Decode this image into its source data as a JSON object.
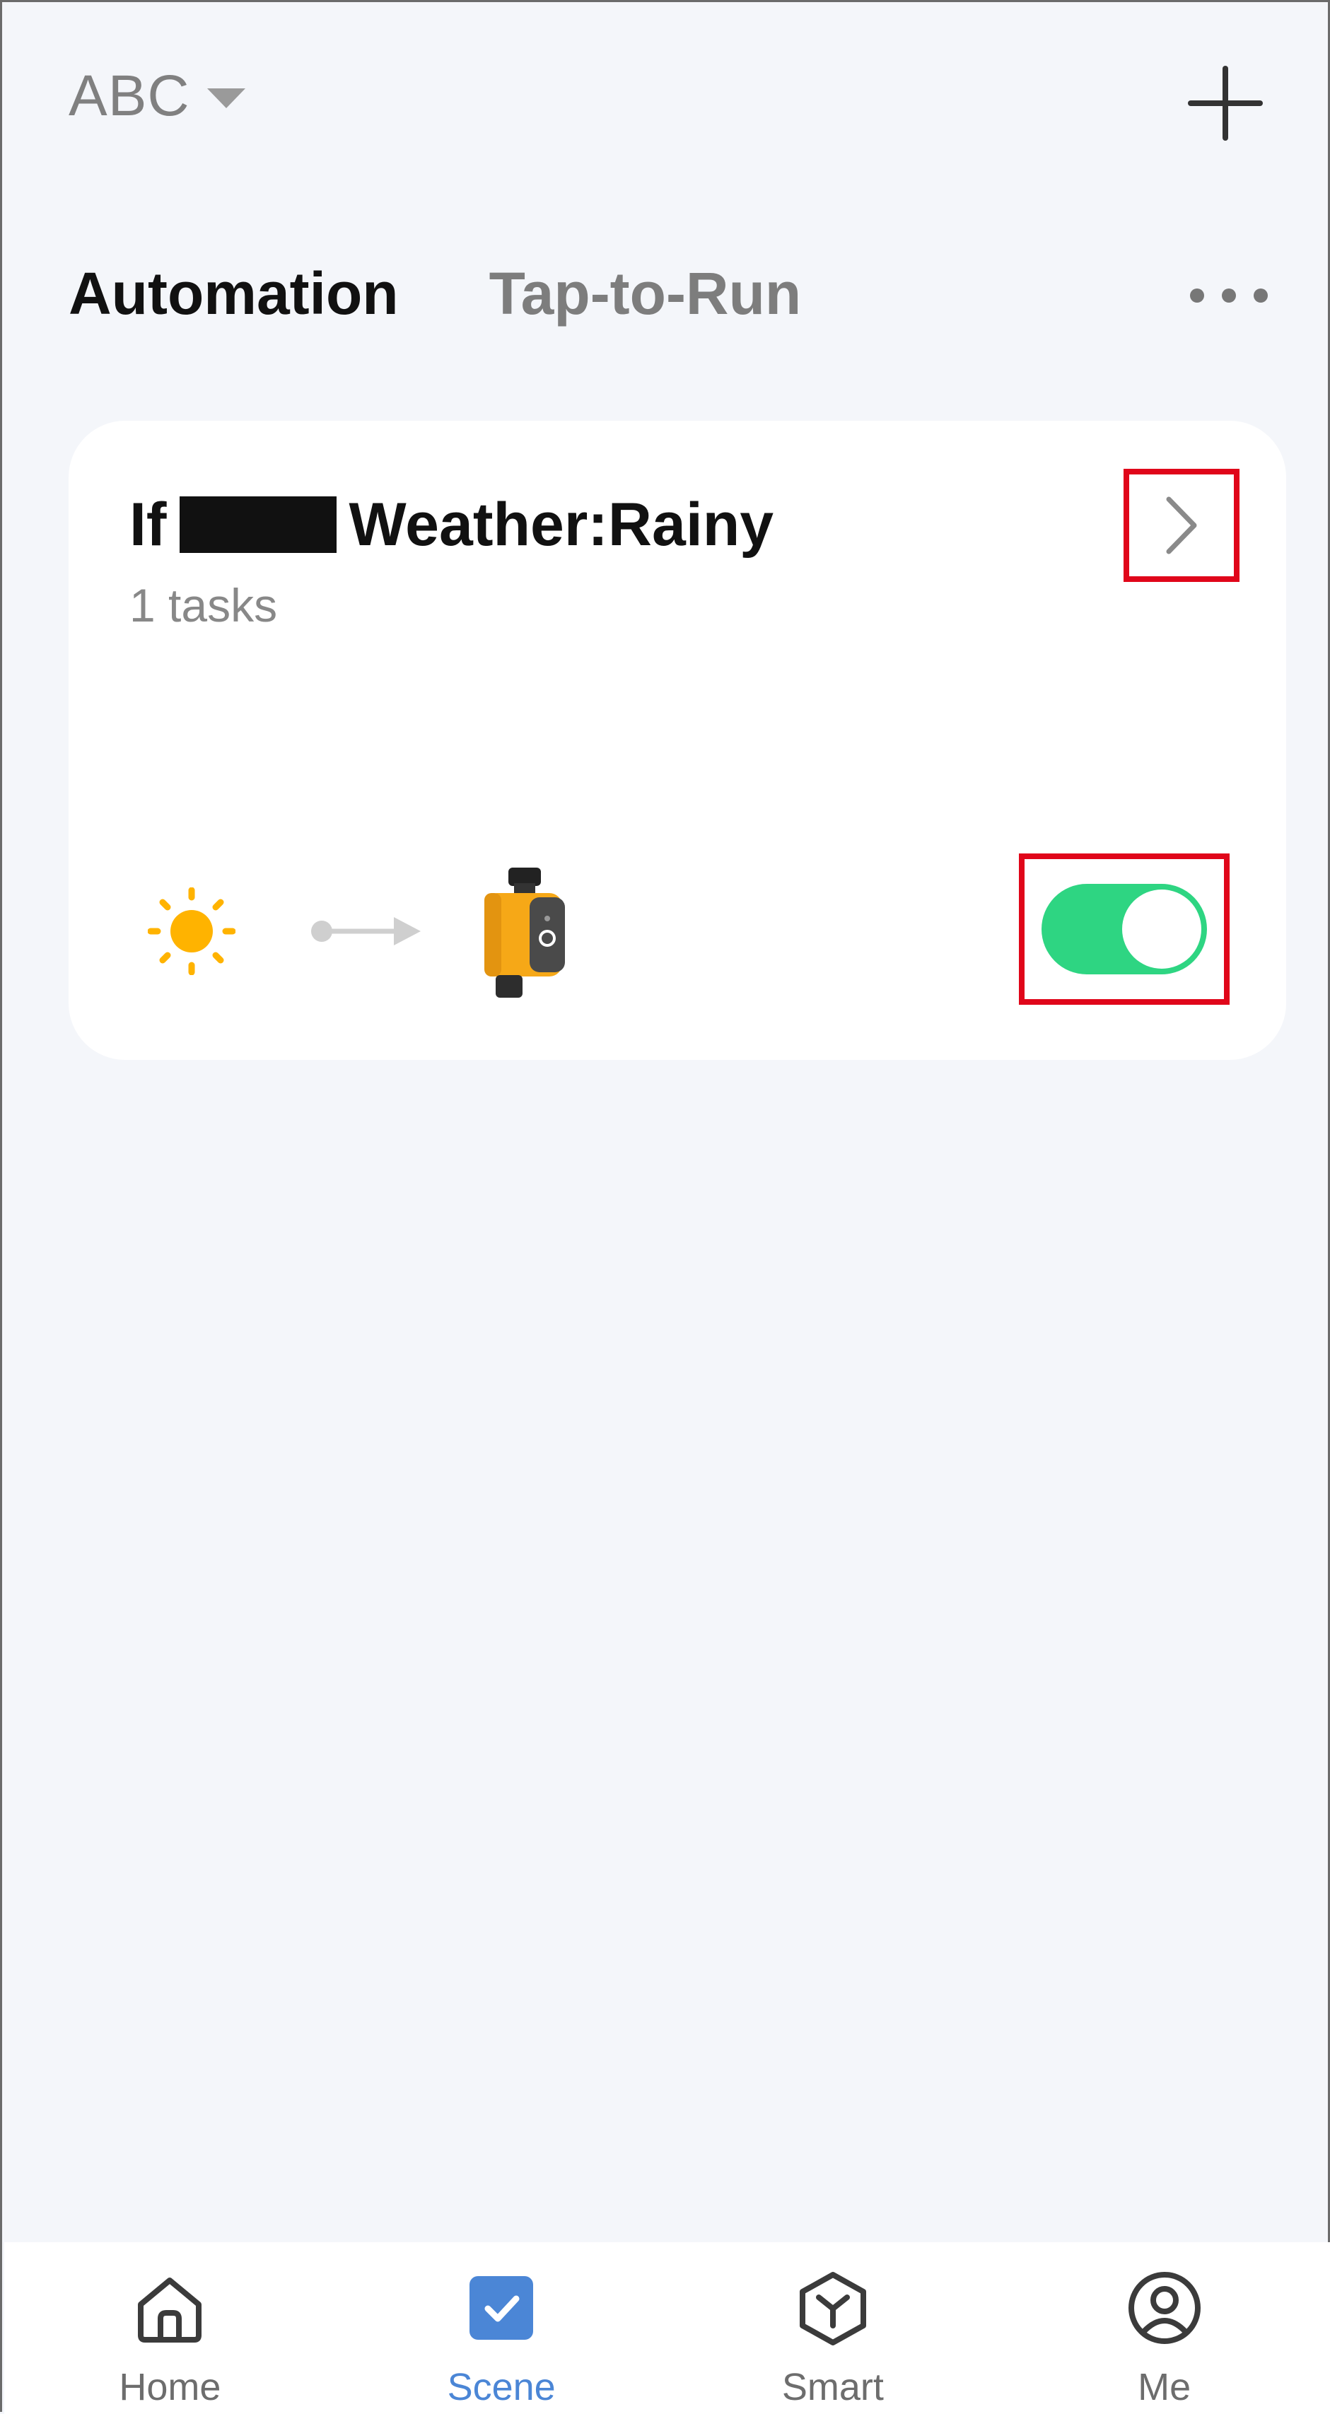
{
  "header": {
    "home_name": "ABC",
    "dropdown_icon": "caret-down-icon",
    "add_icon": "plus-icon"
  },
  "tabs": [
    {
      "label": "Automation",
      "active": true
    },
    {
      "label": "Tap-to-Run",
      "active": false
    }
  ],
  "more_icon": "more-dots-icon",
  "automation_card": {
    "title_prefix": "If",
    "title_redacted": true,
    "title_condition": "Weather:Rainy",
    "subtitle": "1 tasks",
    "condition_icon": "sun-icon",
    "action_icon": "water-timer-device-icon",
    "enabled": true,
    "colors": {
      "toggle_on": "#2ed582",
      "highlight": "#e0061a",
      "sun": "#ffb300"
    }
  },
  "bottom_nav": [
    {
      "label": "Home",
      "icon": "home-icon",
      "active": false
    },
    {
      "label": "Scene",
      "icon": "scene-check-icon",
      "active": true
    },
    {
      "label": "Smart",
      "icon": "smart-cube-icon",
      "active": false
    },
    {
      "label": "Me",
      "icon": "profile-icon",
      "active": false
    }
  ],
  "colors": {
    "accent": "#4b86d6",
    "background": "#f4f6fa"
  }
}
